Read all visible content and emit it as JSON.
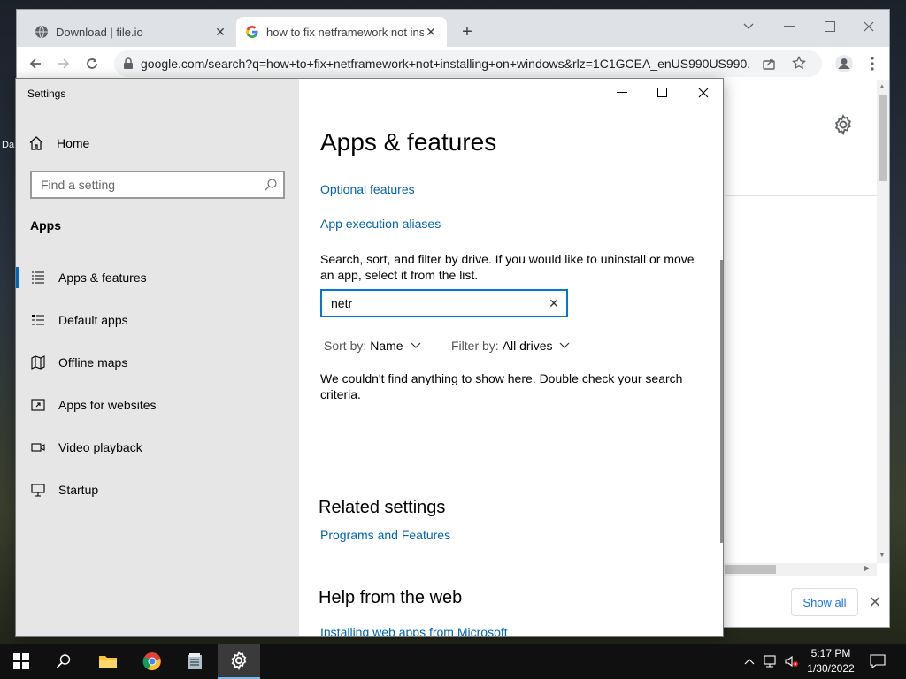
{
  "desktop": {
    "stray_label": "Da"
  },
  "browser": {
    "tabs": [
      {
        "label": "Download | file.io",
        "favicon": "globe-icon"
      },
      {
        "label": "how to fix netframework not inst",
        "favicon": "google-icon"
      }
    ],
    "new_tab": "+",
    "url": "google.com/search?q=how+to+fix+netframework+not+installing+on+windows&rlz=1C1GCEA_enUS990US990...",
    "download_bar": {
      "show_all_label": "Show all"
    }
  },
  "settings": {
    "window_title": "Settings",
    "home_label": "Home",
    "search_placeholder": "Find a setting",
    "section_heading": "Apps",
    "nav": [
      {
        "label": "Apps & features",
        "icon": "list-icon",
        "active": true
      },
      {
        "label": "Default apps",
        "icon": "default-apps-icon",
        "active": false
      },
      {
        "label": "Offline maps",
        "icon": "map-icon",
        "active": false
      },
      {
        "label": "Apps for websites",
        "icon": "web-link-icon",
        "active": false
      },
      {
        "label": "Video playback",
        "icon": "video-icon",
        "active": false
      },
      {
        "label": "Startup",
        "icon": "startup-icon",
        "active": false
      }
    ],
    "main": {
      "title": "Apps & features",
      "optional_features": "Optional features",
      "app_execution_aliases": "App execution aliases",
      "description": "Search, sort, and filter by drive. If you would like to uninstall or move an app, select it from the list.",
      "search_value": "netr",
      "sort_label": "Sort by:",
      "sort_value": "Name",
      "filter_label": "Filter by:",
      "filter_value": "All drives",
      "empty_message": "We couldn't find anything to show here. Double check your search criteria.",
      "related_heading": "Related settings",
      "programs_and_features": "Programs and Features",
      "help_heading": "Help from the web",
      "help_link": "Installing web apps from Microsoft"
    }
  },
  "taskbar": {
    "time": "5:17 PM",
    "date": "1/30/2022"
  },
  "colors": {
    "accent": "#0078d4",
    "link": "#0063b1",
    "taskbar": "#101010"
  }
}
